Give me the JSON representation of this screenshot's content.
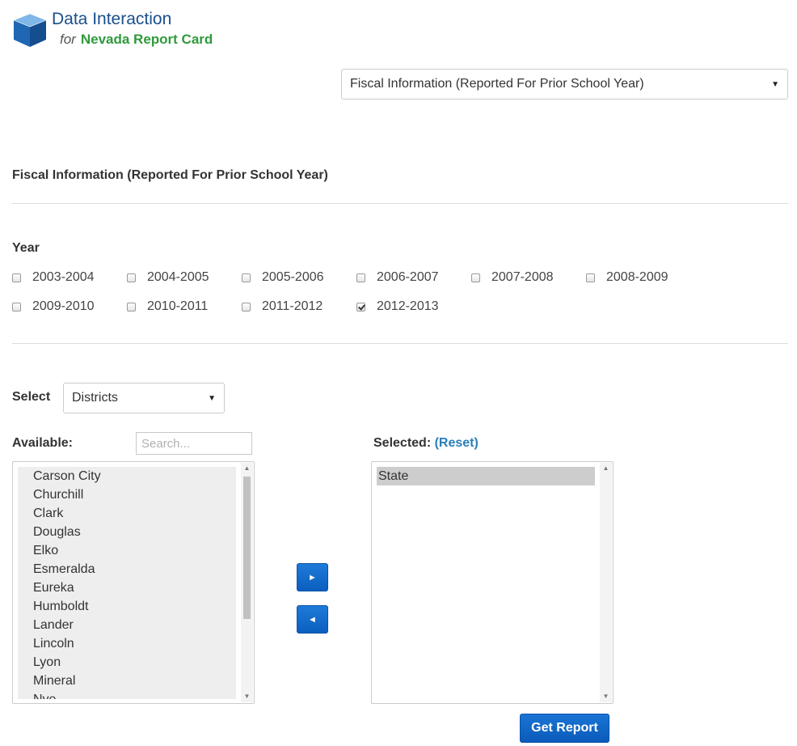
{
  "logo": {
    "title": "Data Interaction",
    "for_text": "for",
    "brand": "Nevada Report Card",
    "icon": "cube-icon"
  },
  "report_select": {
    "value": "Fiscal Information (Reported For Prior School Year)",
    "caret": "▼"
  },
  "section": {
    "title": "Fiscal Information (Reported For Prior School Year)"
  },
  "year": {
    "label": "Year",
    "options": [
      {
        "label": "2003-2004",
        "checked": false
      },
      {
        "label": "2004-2005",
        "checked": false
      },
      {
        "label": "2005-2006",
        "checked": false
      },
      {
        "label": "2006-2007",
        "checked": false
      },
      {
        "label": "2007-2008",
        "checked": false
      },
      {
        "label": "2008-2009",
        "checked": false
      },
      {
        "label": "2009-2010",
        "checked": false
      },
      {
        "label": "2010-2011",
        "checked": false
      },
      {
        "label": "2011-2012",
        "checked": false
      },
      {
        "label": "2012-2013",
        "checked": true
      }
    ]
  },
  "filter": {
    "label": "Select",
    "value": "Districts",
    "caret": "▼"
  },
  "available": {
    "label": "Available:",
    "search_placeholder": "Search...",
    "items": [
      "Carson City",
      "Churchill",
      "Clark",
      "Douglas",
      "Elko",
      "Esmeralda",
      "Eureka",
      "Humboldt",
      "Lander",
      "Lincoln",
      "Lyon",
      "Mineral",
      "Nye"
    ]
  },
  "selected": {
    "label": "Selected:",
    "reset_label": "(Reset)",
    "items": [
      "State"
    ]
  },
  "buttons": {
    "move_right": "►",
    "move_left": "◄",
    "get_report": "Get Report"
  },
  "scroll": {
    "up": "▲",
    "down": "▼"
  },
  "colors": {
    "brand_blue": "#1a4f8c",
    "brand_green": "#2f9a3b",
    "button_blue": "#0c5fbe",
    "link": "#2a7fb8"
  }
}
